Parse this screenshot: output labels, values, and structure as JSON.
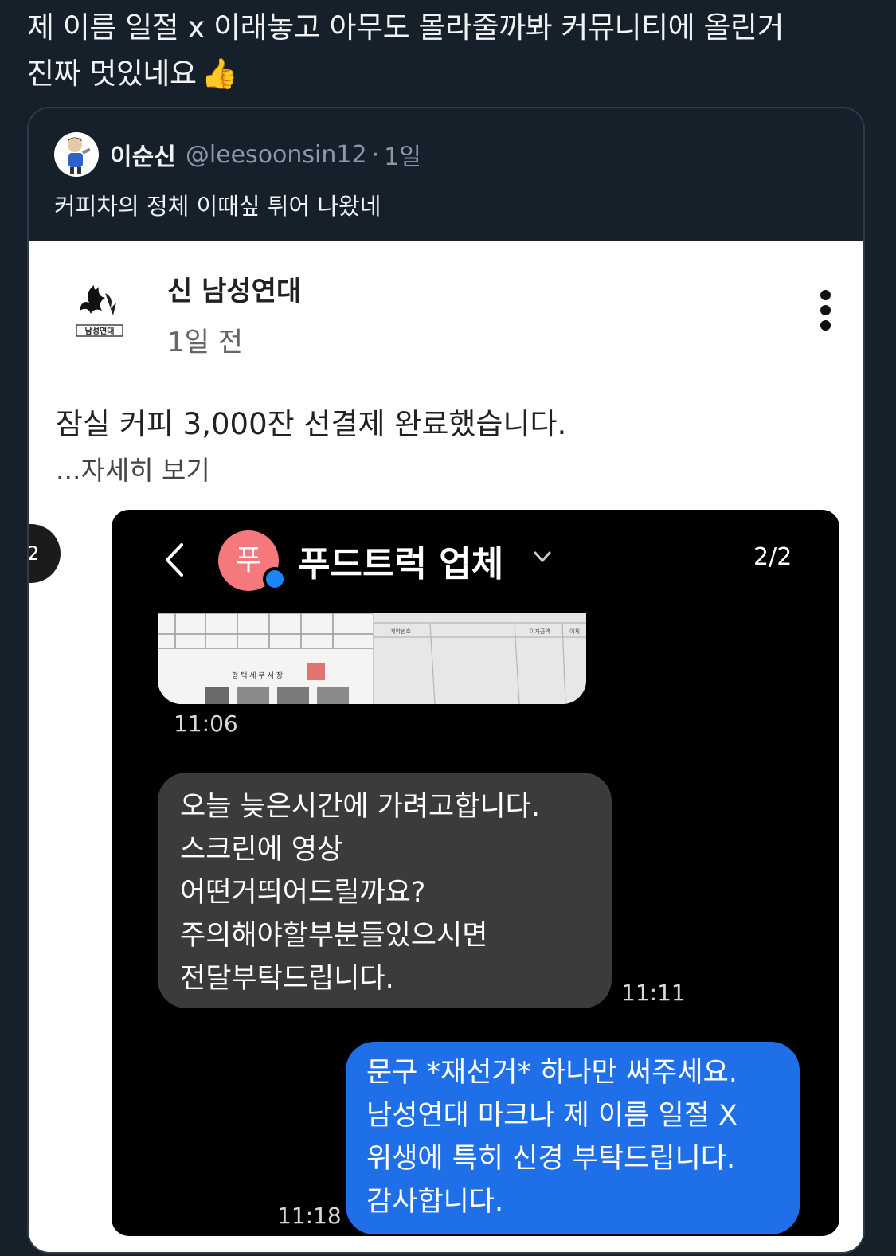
{
  "tweet": {
    "text_line1": "제 이름 일절 x 이래놓고 아무도 몰라줄까봐 커뮤니티에 올린거",
    "text_line2": "진짜 멋있네요",
    "emoji": "👍"
  },
  "quote": {
    "author_name": "이순신",
    "handle": "@leesoonsin12",
    "separator": "·",
    "time": "1일",
    "text": "커피차의 정체 이때싶 튀어 나왔네"
  },
  "community_post": {
    "group_name": "신 남성연대",
    "logo_text": "남성연대",
    "time": "1일 전",
    "body": "잠실 커피 3,000잔 선결제 완료했습니다.",
    "more_label": "...자세히 보기",
    "side_badge": "2"
  },
  "chat": {
    "avatar_initial": "푸",
    "title": "푸드트럭 업체",
    "page_indicator": "2/2",
    "image_caption": "평 택 세 무 서 장",
    "image_header": [
      "계약번호",
      "이자금액",
      "이체"
    ],
    "messages": [
      {
        "direction": "incoming",
        "lines": [
          "오늘 늦은시간에 가려고합니다.",
          "스크린에 영상",
          "어떤거띄어드릴까요?",
          "주의해야할부분들있으시면",
          "전달부탁드립니다."
        ],
        "time": "11:11"
      },
      {
        "direction": "outgoing",
        "lines": [
          "문구 *재선거* 하나만 써주세요.",
          "남성연대 마크나 제 이름 일절 X",
          "위생에 특히 신경 부탁드립니다.",
          "감사합니다."
        ],
        "time": "11:18"
      }
    ],
    "image_time": "11:06"
  },
  "colors": {
    "background": "#15202b",
    "outgoing_bubble": "#1e6fe8",
    "incoming_bubble": "#3b3b3b",
    "chat_avatar": "#f4787c"
  }
}
